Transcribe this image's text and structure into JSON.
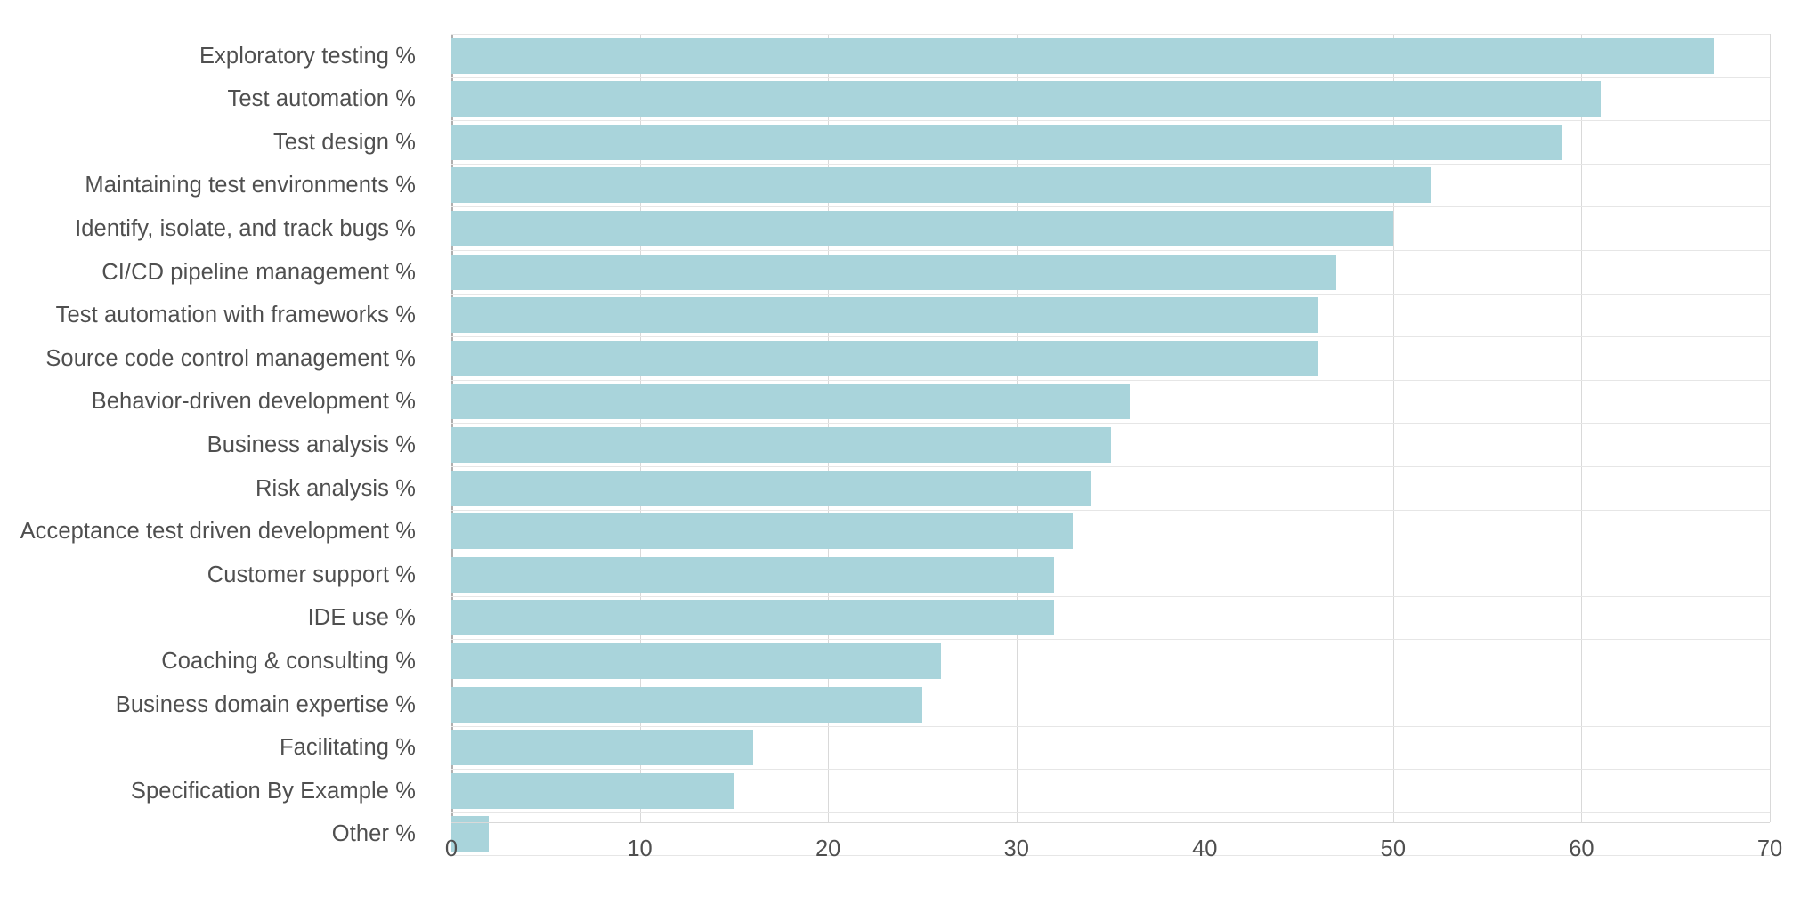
{
  "chart_data": {
    "type": "bar",
    "orientation": "horizontal",
    "title": "",
    "subtitle": "",
    "xlabel": "",
    "ylabel": "",
    "xlim": [
      0,
      70
    ],
    "ylim": null,
    "grid": "vertical-and-row-separators",
    "legend": "none",
    "bar_color": "#a9d4db",
    "axis_text_color": "#4f4f4f",
    "gridline_color": "#d9d9d9",
    "xticks": [
      0,
      10,
      20,
      30,
      40,
      50,
      60,
      70
    ],
    "xtick_labels": [
      "0",
      "10",
      "20",
      "30",
      "40",
      "50",
      "60",
      "70"
    ],
    "categories": [
      "Exploratory testing %",
      "Test automation %",
      "Test design %",
      "Maintaining test environments %",
      "Identify, isolate, and track bugs %",
      "CI/CD pipeline management %",
      "Test automation with frameworks %",
      "Source code control management %",
      "Behavior-driven development %",
      "Business analysis %",
      "Risk analysis %",
      "Acceptance test driven development %",
      "Customer support %",
      "IDE use %",
      "Coaching & consulting %",
      "Business domain expertise %",
      "Facilitating %",
      "Specification By Example %",
      "Other %"
    ],
    "values": [
      67,
      61,
      59,
      52,
      50,
      47,
      46,
      46,
      36,
      35,
      34,
      33,
      32,
      32,
      26,
      25,
      16,
      15,
      2
    ]
  }
}
